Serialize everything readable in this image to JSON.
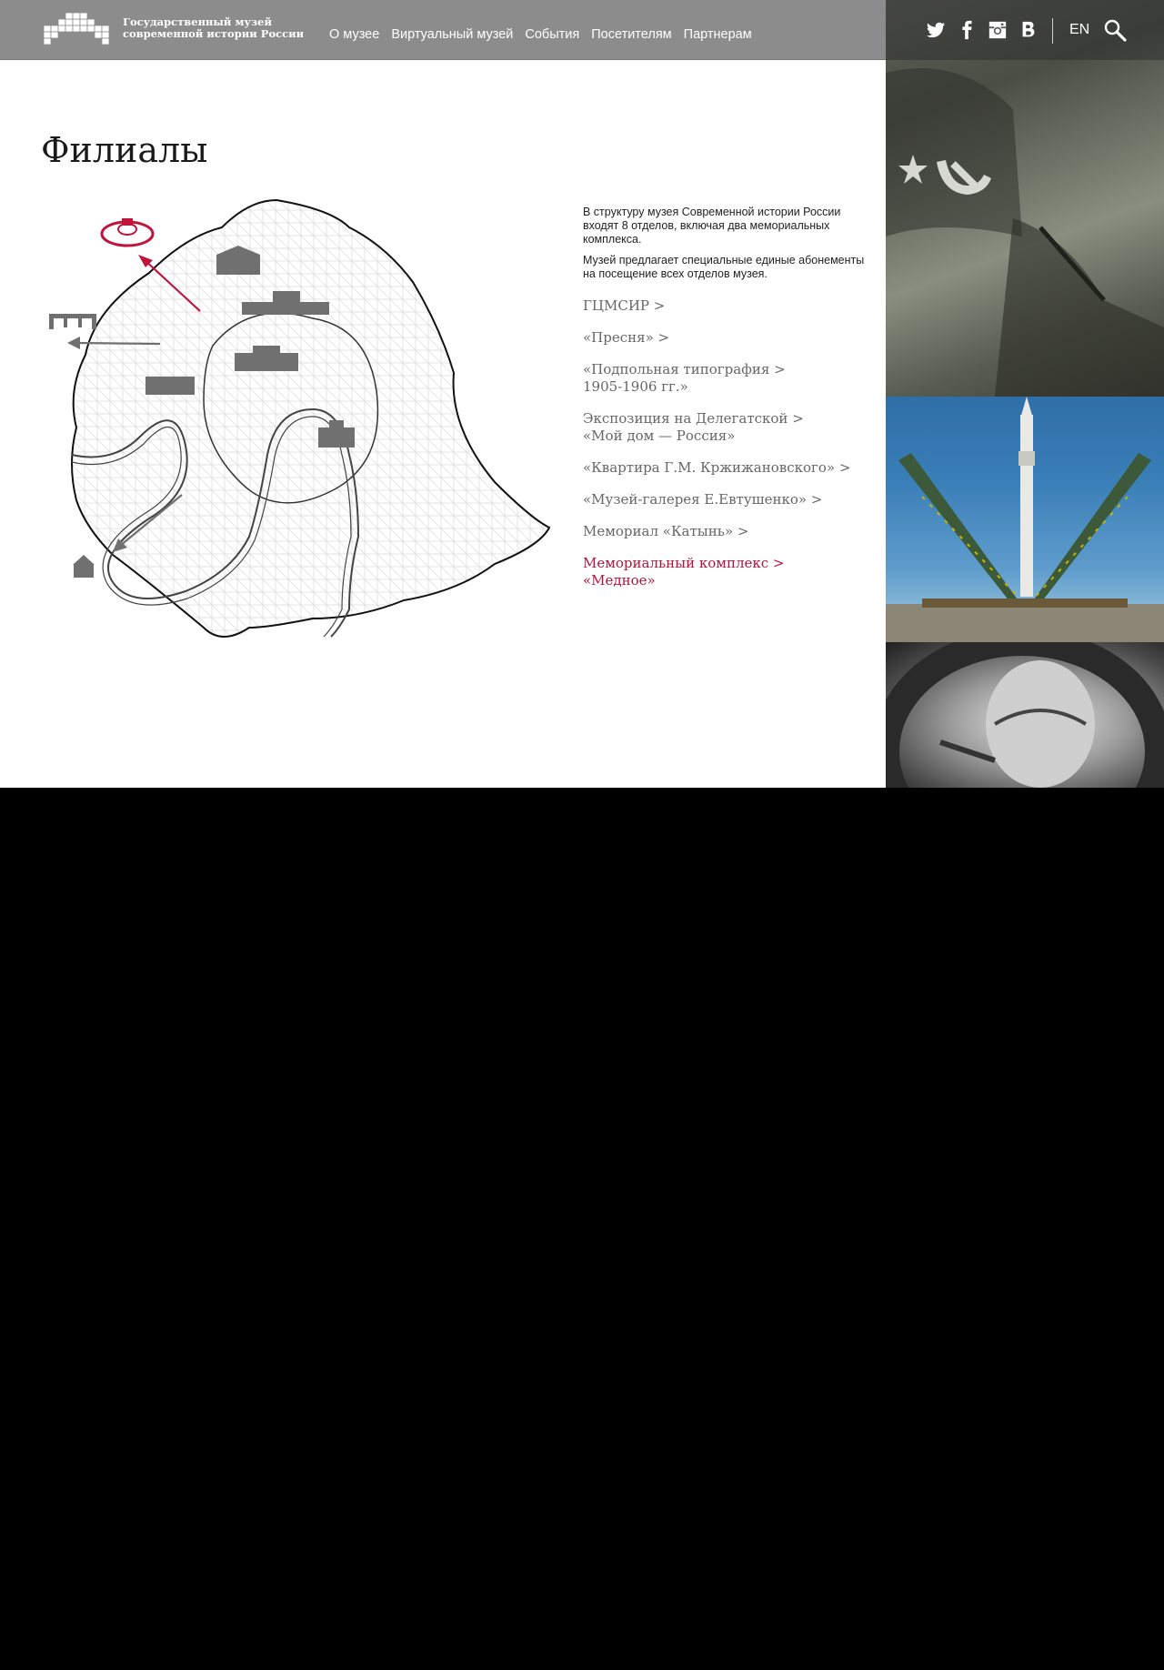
{
  "header": {
    "logo_text_line1": "Государственный музей",
    "logo_text_line2": "современной истории России",
    "nav": [
      "О музее",
      "Виртуальный музей",
      "События",
      "Посетителям",
      "Партнерам"
    ],
    "lang": "EN",
    "social_icons": [
      "twitter-icon",
      "facebook-icon",
      "instagram-icon",
      "vk-icon"
    ]
  },
  "page": {
    "title": "Филиалы",
    "intro": [
      "В структуру музея Современной истории России входят 8 отделов, включая два мемориальных комплекса.",
      "Музей предлагает специальные единые абонементы на посещение всех отделов музея."
    ]
  },
  "branches": [
    {
      "line1": "ГЦМСИР >",
      "line2": ""
    },
    {
      "line1": "«Пресня» >",
      "line2": ""
    },
    {
      "line1": "«Подпольная типография >",
      "line2": "1905-1906 гг.»"
    },
    {
      "line1": "Экспозиция на Делегатской >",
      "line2": "«Мой дом — Россия»"
    },
    {
      "line1": "«Квартира Г.М. Кржижановского» >",
      "line2": ""
    },
    {
      "line1": "«Музей-галерея Е.Евтушенко» >",
      "line2": ""
    },
    {
      "line1": "Мемориал «Катынь» >",
      "line2": ""
    },
    {
      "line1": "Мемориальный комплекс >",
      "line2": "«Медное»",
      "active": true
    }
  ],
  "colors": {
    "header_bg": "#8c8c8c",
    "accent": "#b5123a",
    "link": "#666666",
    "map_icon": "#707070"
  }
}
